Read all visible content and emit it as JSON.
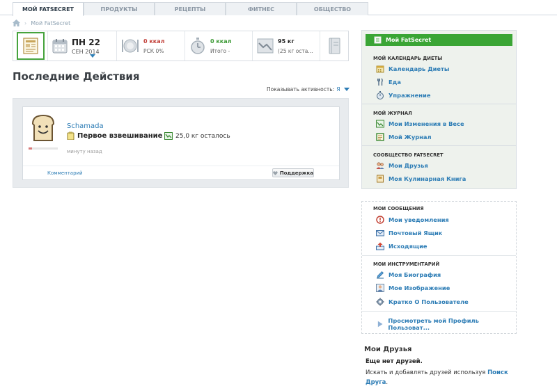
{
  "nav": {
    "tabs": [
      {
        "label": "МОЙ FATSECRET",
        "active": true
      },
      {
        "label": "ПРОДУКТЫ",
        "active": false
      },
      {
        "label": "РЕЦЕПТЫ",
        "active": false
      },
      {
        "label": "ФИТНЕС",
        "active": false
      },
      {
        "label": "ОБЩЕСТВО",
        "active": false
      }
    ]
  },
  "breadcrumb": {
    "current": "Мой FatSecret"
  },
  "summary": {
    "date_day": "ПН 22",
    "date_monthyear": "СЕН 2014",
    "food_kcal": "0 ккал",
    "food_sub": "РСК 0%",
    "exercise_kcal": "0 ккал",
    "exercise_sub": "Итого -",
    "weight_value": "95 кг",
    "weight_sub": "(25 кг оста..."
  },
  "activity": {
    "title": "Последние Действия",
    "filter_label": "Показывать активность:",
    "filter_value": "Я",
    "card": {
      "user_name": "Schamada",
      "event": "Первое взвешивание",
      "remaining": "25,0 кг осталось",
      "time_ago": "минуту назад",
      "comment_link": "Комментарий",
      "support_button": "Поддержка"
    }
  },
  "sidebar": {
    "header": "Мой FatSecret",
    "groups": [
      {
        "title": "МОЙ КАЛЕНДАРЬ ДИЕТЫ",
        "items": [
          "Календарь Диеты",
          "Еда",
          "Упражнение"
        ]
      },
      {
        "title": "МОЙ ЖУРНАЛ",
        "items": [
          "Мои Изменения в Весе",
          "Мой Журнал"
        ]
      },
      {
        "title": "СООБЩЕСТВО FATSECRET",
        "items": [
          "Мои Друзья",
          "Моя Кулинарная Книга"
        ]
      }
    ],
    "messages": {
      "title": "МОИ СООБЩЕНИЯ",
      "items": [
        "Мои уведомления",
        "Почтовый Ящик",
        "Исходящие"
      ]
    },
    "tools": {
      "title": "МОИ ИНСТРУМЕНТАРИЙ",
      "items": [
        "Моя Биография",
        "Мое Изображение",
        "Кратко О Пользователе"
      ]
    },
    "profile_link": "Просмотреть мой Профиль Пользоват..."
  },
  "friends": {
    "title": "Мои Друзья",
    "none": "Еще нет друзей.",
    "add_text": "Искать и добавлять друзей используя",
    "add_link": "Поиск Друга",
    "add_end": "."
  }
}
